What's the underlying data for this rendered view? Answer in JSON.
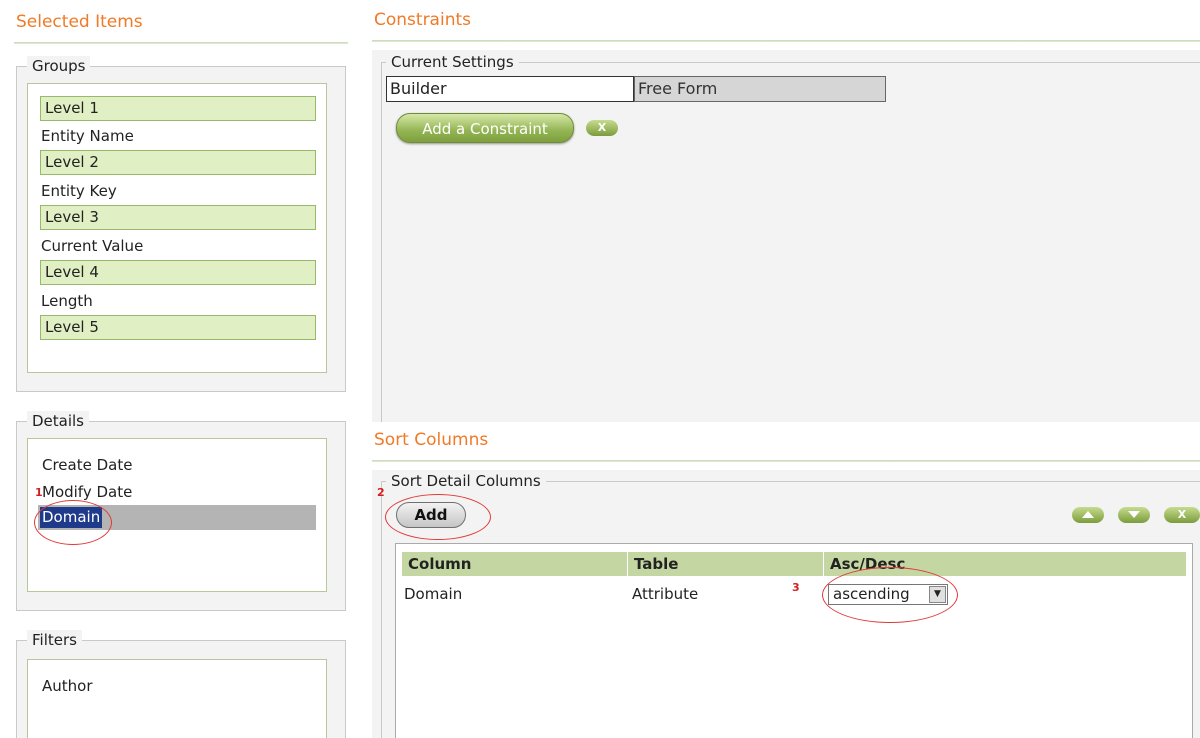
{
  "left": {
    "title": "Selected Items",
    "groups": {
      "legend": "Groups",
      "rows": [
        {
          "label": "Level 1",
          "highlighted": true
        },
        {
          "label": "Entity Name",
          "highlighted": false
        },
        {
          "label": "Level 2",
          "highlighted": true
        },
        {
          "label": "Entity Key",
          "highlighted": false
        },
        {
          "label": "Level 3",
          "highlighted": true
        },
        {
          "label": "Current Value",
          "highlighted": false
        },
        {
          "label": "Level 4",
          "highlighted": true
        },
        {
          "label": "Length",
          "highlighted": false
        },
        {
          "label": "Level 5",
          "highlighted": true
        }
      ]
    },
    "details": {
      "legend": "Details",
      "items": [
        "Create Date",
        "Modify Date",
        "Domain"
      ],
      "selected": "Domain"
    },
    "filters": {
      "legend": "Filters",
      "items": [
        "Author"
      ]
    }
  },
  "constraints": {
    "title": "Constraints",
    "current_settings": {
      "legend": "Current Settings",
      "tabs": [
        "Builder",
        "Free Form"
      ],
      "add_button": "Add a Constraint",
      "remove_button": "X"
    }
  },
  "sort": {
    "title": "Sort Columns",
    "legend": "Sort Detail Columns",
    "add_button": "Add",
    "remove_button": "X",
    "headers": [
      "Column",
      "Table",
      "Asc/Desc"
    ],
    "rows": [
      {
        "column": "Domain",
        "table": "Attribute",
        "order": "ascending"
      }
    ]
  },
  "annotations": [
    "1",
    "2",
    "3"
  ],
  "colors": {
    "accent_orange": "#f07a26",
    "highlight_green": "#e1f0c4",
    "header_green": "#c4d7a2",
    "annotation_red": "#e03a3a"
  }
}
